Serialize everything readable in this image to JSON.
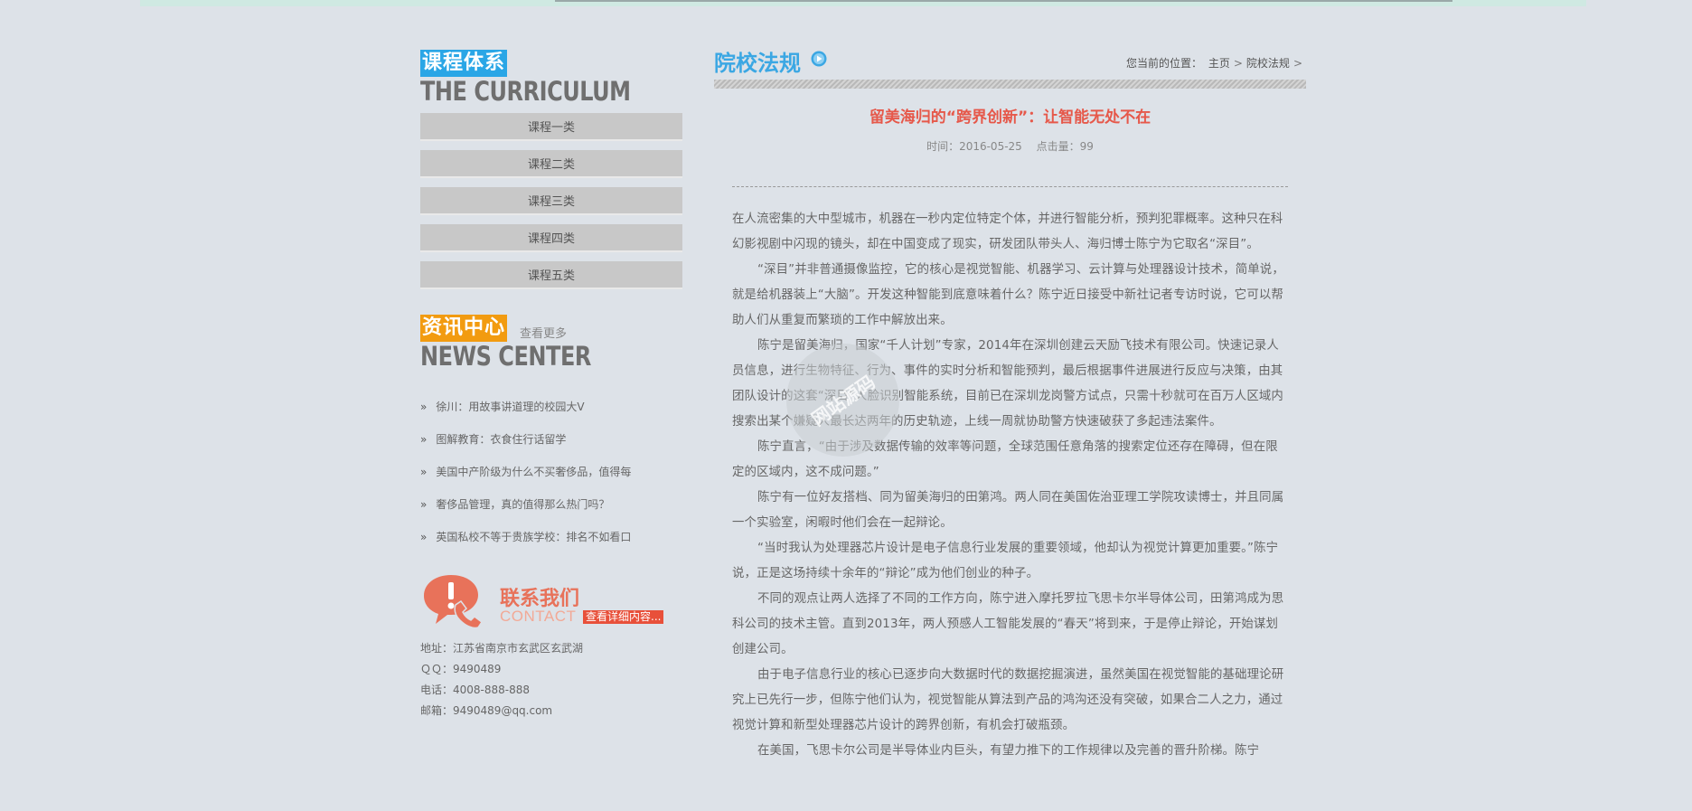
{
  "sidebar": {
    "curriculum": {
      "title_cn": "课程体系",
      "title_en": "THE CURRICULUM",
      "items": [
        "课程一类",
        "课程二类",
        "课程三类",
        "课程四类",
        "课程五类"
      ]
    },
    "news": {
      "title_cn": "资讯中心",
      "title_en": "NEWS CENTER",
      "more": "查看更多",
      "items": [
        "徐川：用故事讲道理的校园大V",
        "图解教育：衣食住行话留学",
        "美国中产阶级为什么不买奢侈品，值得每",
        "奢侈品管理，真的值得那么热门吗？",
        "英国私校不等于贵族学校：排名不如看口"
      ]
    },
    "contact": {
      "title_cn": "联系我们",
      "title_en": "CONTACT",
      "more": "查看详细内容...",
      "address": "地址：江苏省南京市玄武区玄武湖",
      "qq": "ＱＱ：9490489",
      "phone": "电话：4008-888-888",
      "email": "邮箱：9490489@qq.com"
    }
  },
  "main": {
    "section_title": "院校法规",
    "breadcrumb": {
      "prefix": "您当前的位置：",
      "home": "主页",
      "current": "院校法规"
    },
    "article": {
      "title": "留美海归的“跨界创新”：让智能无处不在",
      "date": "时间：2016-05-25",
      "hits": "点击量：99",
      "paragraphs": [
        "在人流密集的大中型城市，机器在一秒内定位特定个体，并进行智能分析，预判犯罪概率。这种只在科幻影视剧中闪现的镜头，却在中国变成了现实，研发团队带头人、海归博士陈宁为它取名“深目”。",
        "“深目”并非普通摄像监控，它的核心是视觉智能、机器学习、云计算与处理器设计技术，简单说，就是给机器装上“大脑”。开发这种智能到底意味着什么？陈宁近日接受中新社记者专访时说，它可以帮助人们从重复而繁琐的工作中解放出来。",
        "陈宁是留美海归，国家“千人计划”专家，2014年在深圳创建云天励飞技术有限公司。快速记录人员信息，进行生物特征、行为、事件的实时分析和智能预判，最后根据事件进展进行反应与决策，由其团队设计的这套“深目”人脸识别智能系统，目前已在深圳龙岗警方试点，只需十秒就可在百万人区域内搜索出某个嫌疑人最长达两年的历史轨迹，上线一周就协助警方快速破获了多起违法案件。",
        "陈宁直言，“由于涉及数据传输的效率等问题，全球范围任意角落的搜索定位还存在障碍，但在限定的区域内，这不成问题。”",
        "陈宁有一位好友搭档、同为留美海归的田第鸿。两人同在美国佐治亚理工学院攻读博士，并且同属一个实验室，闲暇时他们会在一起辩论。",
        "“当时我认为处理器芯片设计是电子信息行业发展的重要领域，他却认为视觉计算更加重要。”陈宁说，正是这场持续十余年的“辩论”成为他们创业的种子。",
        "不同的观点让两人选择了不同的工作方向，陈宁进入摩托罗拉飞思卡尔半导体公司，田第鸿成为思科公司的技术主管。直到2013年，两人预感人工智能发展的“春天”将到来，于是停止辩论，开始谋划创建公司。",
        "由于电子信息行业的核心已逐步向大数据时代的数据挖掘演进，虽然美国在视觉智能的基础理论研究上已先行一步，但陈宁他们认为，视觉智能从算法到产品的鸿沟还没有突破，如果合二人之力，通过视觉计算和新型处理器芯片设计的跨界创新，有机会打破瓶颈。",
        "在美国，飞思卡尔公司是半导体业内巨头，有望力推下的工作规律以及完善的晋升阶梯。陈宁"
      ]
    }
  },
  "watermark": "网站源码"
}
